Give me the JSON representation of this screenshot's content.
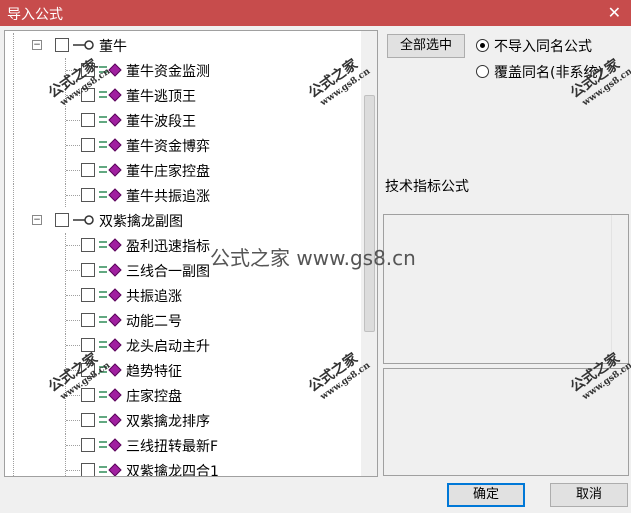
{
  "window": {
    "title": "导入公式",
    "close_glyph": "✕"
  },
  "tree": {
    "groups": [
      {
        "label": "董牛",
        "expander": "−",
        "items": [
          "董牛资金监测",
          "董牛逃顶王",
          "董牛波段王",
          "董牛资金博弈",
          "董牛庄家控盘",
          "董牛共振追涨"
        ]
      },
      {
        "label": "双紫擒龙副图",
        "expander": "−",
        "items": [
          "盈利迅速指标",
          "三线合一副图",
          "共振追涨",
          "动能二号",
          "龙头启动主升",
          "趋势特征",
          "庄家控盘",
          "双紫擒龙排序",
          "三线扭转最新F",
          "双紫擒龙四合1"
        ]
      }
    ]
  },
  "options": {
    "select_all_label": "全部选中",
    "radio_skip_label": "不导入同名公式",
    "radio_overwrite_label": "覆盖同名(非系统)",
    "selected": "skip"
  },
  "info": {
    "formula_type_label": "技术指标公式"
  },
  "footer": {
    "ok_label": "确定",
    "cancel_label": "取消"
  },
  "watermark": {
    "text": "公式之家",
    "url": "www.gs8.cn",
    "center": "公式之家 www.gs8.cn"
  },
  "colors": {
    "titlebar": "#c74c4c",
    "icon_purple": "#a020a0",
    "icon_green": "#2e8b57"
  }
}
